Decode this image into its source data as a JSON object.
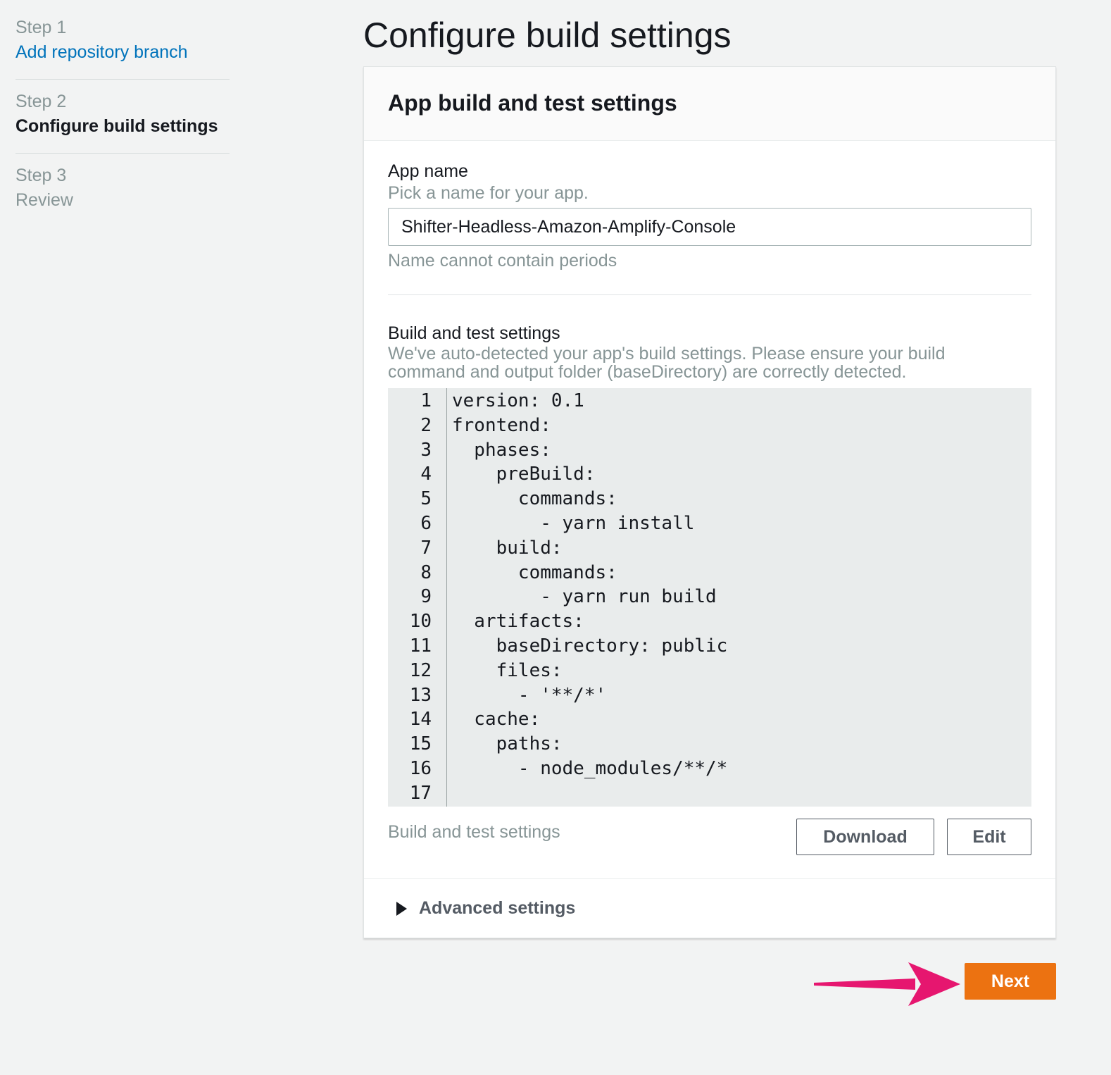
{
  "steps": [
    {
      "number": "Step 1",
      "title": "Add repository branch"
    },
    {
      "number": "Step 2",
      "title": "Configure build settings"
    },
    {
      "number": "Step 3",
      "title": "Review"
    }
  ],
  "page": {
    "title": "Configure build settings"
  },
  "panel": {
    "title": "App build and test settings",
    "app_name": {
      "label": "App name",
      "description": "Pick a name for your app.",
      "value": "Shifter-Headless-Amazon-Amplify-Console",
      "constraint": "Name cannot contain periods"
    },
    "build_settings": {
      "label": "Build and test settings",
      "description_line1": "We've auto-detected your app's build settings. Please ensure your build",
      "description_line2": "command and output folder (baseDirectory) are correctly detected.",
      "footer_label": "Build and test settings",
      "download_label": "Download",
      "edit_label": "Edit",
      "code_lines": [
        "version: 0.1",
        "frontend:",
        "  phases:",
        "    preBuild:",
        "      commands:",
        "        - yarn install",
        "    build:",
        "      commands:",
        "        - yarn run build",
        "  artifacts:",
        "    baseDirectory: public",
        "    files:",
        "      - '**/*'",
        "  cache:",
        "    paths:",
        "      - node_modules/**/*",
        ""
      ]
    },
    "advanced_label": "Advanced settings"
  },
  "next_label": "Next",
  "colors": {
    "accent": "#ec7211",
    "link": "#0073bb",
    "arrow": "#e6166f"
  }
}
